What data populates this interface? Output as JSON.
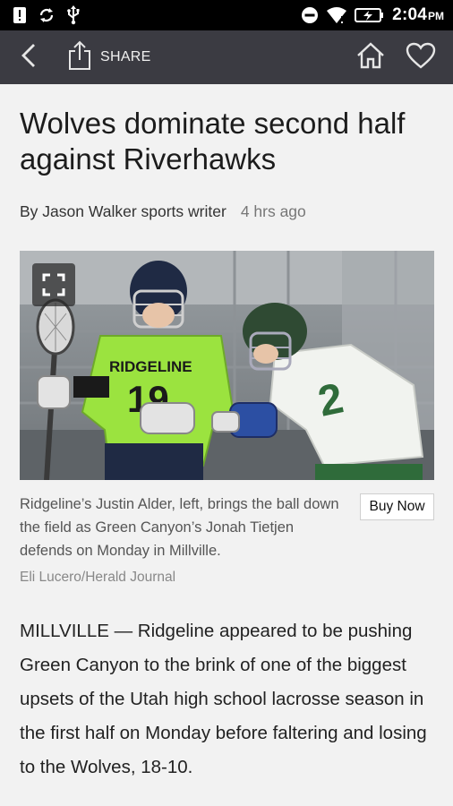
{
  "status_bar": {
    "time": "2:04",
    "ampm": "PM",
    "left_icons": [
      "alert-icon",
      "sync-icon",
      "usb-icon"
    ],
    "right_icons": [
      "do-not-disturb-icon",
      "wifi-icon",
      "battery-charging-icon"
    ]
  },
  "app_bar": {
    "share_label": "SHARE",
    "background_color": "#3b3b42"
  },
  "article": {
    "headline": "Wolves dominate second half against Riverhawks",
    "byline": "By Jason Walker sports writer",
    "time_ago": "4 hrs ago",
    "photo": {
      "jersey_left_text": "RIDGELINE",
      "jersey_left_number": "19",
      "jersey_right_number": "2"
    },
    "caption": "Ridgeline’s Justin Alder, left, brings the ball down the field as Green Canyon’s Jonah Tietjen defends on Monday in Millville.",
    "credit": "Eli Lucero/Herald Journal",
    "buy_label": "Buy Now",
    "body": "MILLVILLE — Ridgeline appeared to be pushing Green Canyon to the brink of one of the biggest upsets of the Utah high school lacrosse season in the first half on Monday before faltering and losing to the Wolves, 18-10."
  }
}
